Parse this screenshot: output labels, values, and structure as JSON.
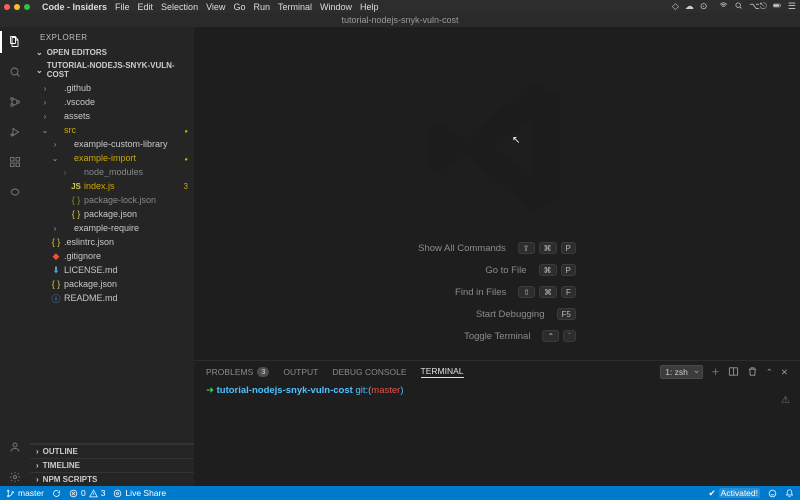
{
  "mac": {
    "app": "Code - Insiders",
    "menus": [
      "File",
      "Edit",
      "Selection",
      "View",
      "Go",
      "Run",
      "Terminal",
      "Window",
      "Help"
    ],
    "rightIcons": [
      "diamond",
      "cloud",
      "circle",
      "apple",
      "wifi",
      "search",
      "toggle",
      "battery",
      "hamburger"
    ]
  },
  "titlebar": "tutorial-nodejs-snyk-vuln-cost",
  "sidebar": {
    "title": "EXPLORER",
    "openEditors": "OPEN EDITORS",
    "project": "TUTORIAL-NODEJS-SNYK-VULN-COST",
    "tree": [
      {
        "type": "folder",
        "name": ".github",
        "depth": 0,
        "open": false
      },
      {
        "type": "folder",
        "name": ".vscode",
        "depth": 0,
        "open": false
      },
      {
        "type": "folder",
        "name": "assets",
        "depth": 0,
        "open": false
      },
      {
        "type": "folder",
        "name": "src",
        "depth": 0,
        "open": true,
        "modified": true
      },
      {
        "type": "folder",
        "name": "example-custom-library",
        "depth": 1,
        "open": false
      },
      {
        "type": "folder",
        "name": "example-import",
        "depth": 1,
        "open": true,
        "modified": true
      },
      {
        "type": "folder",
        "name": "node_modules",
        "depth": 2,
        "open": false,
        "dim": true
      },
      {
        "type": "file",
        "name": "index.js",
        "depth": 2,
        "icon": "js",
        "modified": true,
        "badge": "3"
      },
      {
        "type": "file",
        "name": "package-lock.json",
        "depth": 2,
        "icon": "json",
        "dim": true
      },
      {
        "type": "file",
        "name": "package.json",
        "depth": 2,
        "icon": "json"
      },
      {
        "type": "folder",
        "name": "example-require",
        "depth": 1,
        "open": false
      },
      {
        "type": "file",
        "name": ".eslintrc.json",
        "depth": 0,
        "icon": "json"
      },
      {
        "type": "file",
        "name": ".gitignore",
        "depth": 0,
        "icon": "git"
      },
      {
        "type": "file",
        "name": "LICENSE.md",
        "depth": 0,
        "icon": "md-blue"
      },
      {
        "type": "file",
        "name": "package.json",
        "depth": 0,
        "icon": "json"
      },
      {
        "type": "file",
        "name": "README.md",
        "depth": 0,
        "icon": "md-info"
      }
    ],
    "collapsed": [
      "OUTLINE",
      "TIMELINE",
      "NPM SCRIPTS"
    ]
  },
  "welcome": {
    "shortcuts": [
      {
        "label": "Show All Commands",
        "keys": [
          "⇧",
          "⌘",
          "P"
        ]
      },
      {
        "label": "Go to File",
        "keys": [
          "⌘",
          "P"
        ]
      },
      {
        "label": "Find in Files",
        "keys": [
          "⇧",
          "⌘",
          "F"
        ]
      },
      {
        "label": "Start Debugging",
        "keys": [
          "F5"
        ]
      },
      {
        "label": "Toggle Terminal",
        "keys": [
          "⌃",
          "`"
        ]
      }
    ]
  },
  "panel": {
    "tabs": {
      "problems": "PROBLEMS",
      "problemsCount": "3",
      "output": "OUTPUT",
      "debugConsole": "DEBUG CONSOLE",
      "terminal": "TERMINAL"
    },
    "terminalSelector": "1: zsh",
    "promptDir": "tutorial-nodejs-snyk-vuln-cost",
    "promptGit": "git:(",
    "promptBranch": "master",
    "promptClose": ")"
  },
  "statusbar": {
    "branch": "master",
    "sync": "",
    "errors": "0",
    "warnings": "3",
    "liveShare": "Live Share",
    "activated": "Activated!",
    "bell": "",
    "broadcast": ""
  }
}
